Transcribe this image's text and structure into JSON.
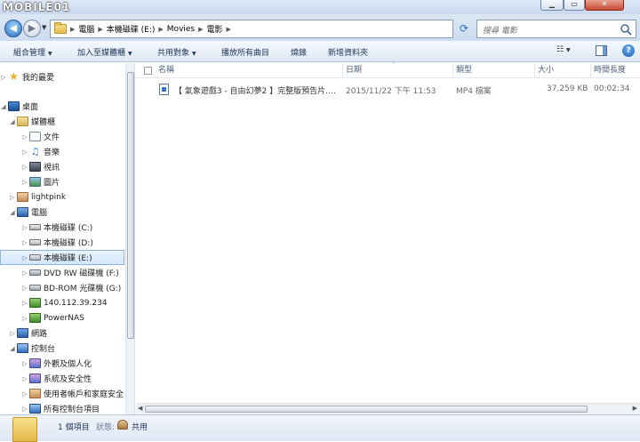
{
  "watermark": "MOBILE01",
  "window_buttons": {
    "minimize": "▁",
    "maximize": "▭",
    "close": "✕"
  },
  "address": {
    "crumbs": [
      "電腦",
      "本機磁碟 (E:)",
      "Movies",
      "電影"
    ]
  },
  "search": {
    "placeholder": "搜尋 電影"
  },
  "toolbar": {
    "organize": "組合管理",
    "add_library": "加入至媒體櫃",
    "share": "共用對象",
    "play_all": "播放所有曲目",
    "burn": "燒錄",
    "new_folder": "新增資料夾",
    "help": "?"
  },
  "nav": {
    "items": [
      {
        "label": "我的最愛"
      },
      {
        "label": "桌面"
      },
      {
        "label": "媒體櫃"
      },
      {
        "label": "文件"
      },
      {
        "label": "音樂"
      },
      {
        "label": "視訊"
      },
      {
        "label": "圖片"
      },
      {
        "label": "lightpink"
      },
      {
        "label": "電腦"
      },
      {
        "label": "本機磁碟 (C:)"
      },
      {
        "label": "本機磁碟 (D:)"
      },
      {
        "label": "本機磁碟 (E:)"
      },
      {
        "label": "DVD RW 磁碟機 (F:)"
      },
      {
        "label": "BD-ROM 光碟機 (G:)"
      },
      {
        "label": "140.112.39.234"
      },
      {
        "label": "PowerNAS"
      },
      {
        "label": "網路"
      },
      {
        "label": "控制台"
      },
      {
        "label": "外觀及個人化"
      },
      {
        "label": "系統及安全性"
      },
      {
        "label": "使用者帳戶和家庭安全"
      },
      {
        "label": "所有控制台項目"
      }
    ]
  },
  "columns": {
    "name": "名稱",
    "date": "日期",
    "type": "類型",
    "size": "大小",
    "length": "時間長度"
  },
  "files": [
    {
      "name": "【 氣象遊戲3 - 自由幻夢2 】完整版預告片.…",
      "date": "2015/11/22 下午 11:53",
      "type": "MP4 檔案",
      "size": "37,259 KB",
      "length": "00:02:34"
    }
  ],
  "status": {
    "count": "1 個項目",
    "state_label": "狀態:",
    "share": "共用"
  }
}
